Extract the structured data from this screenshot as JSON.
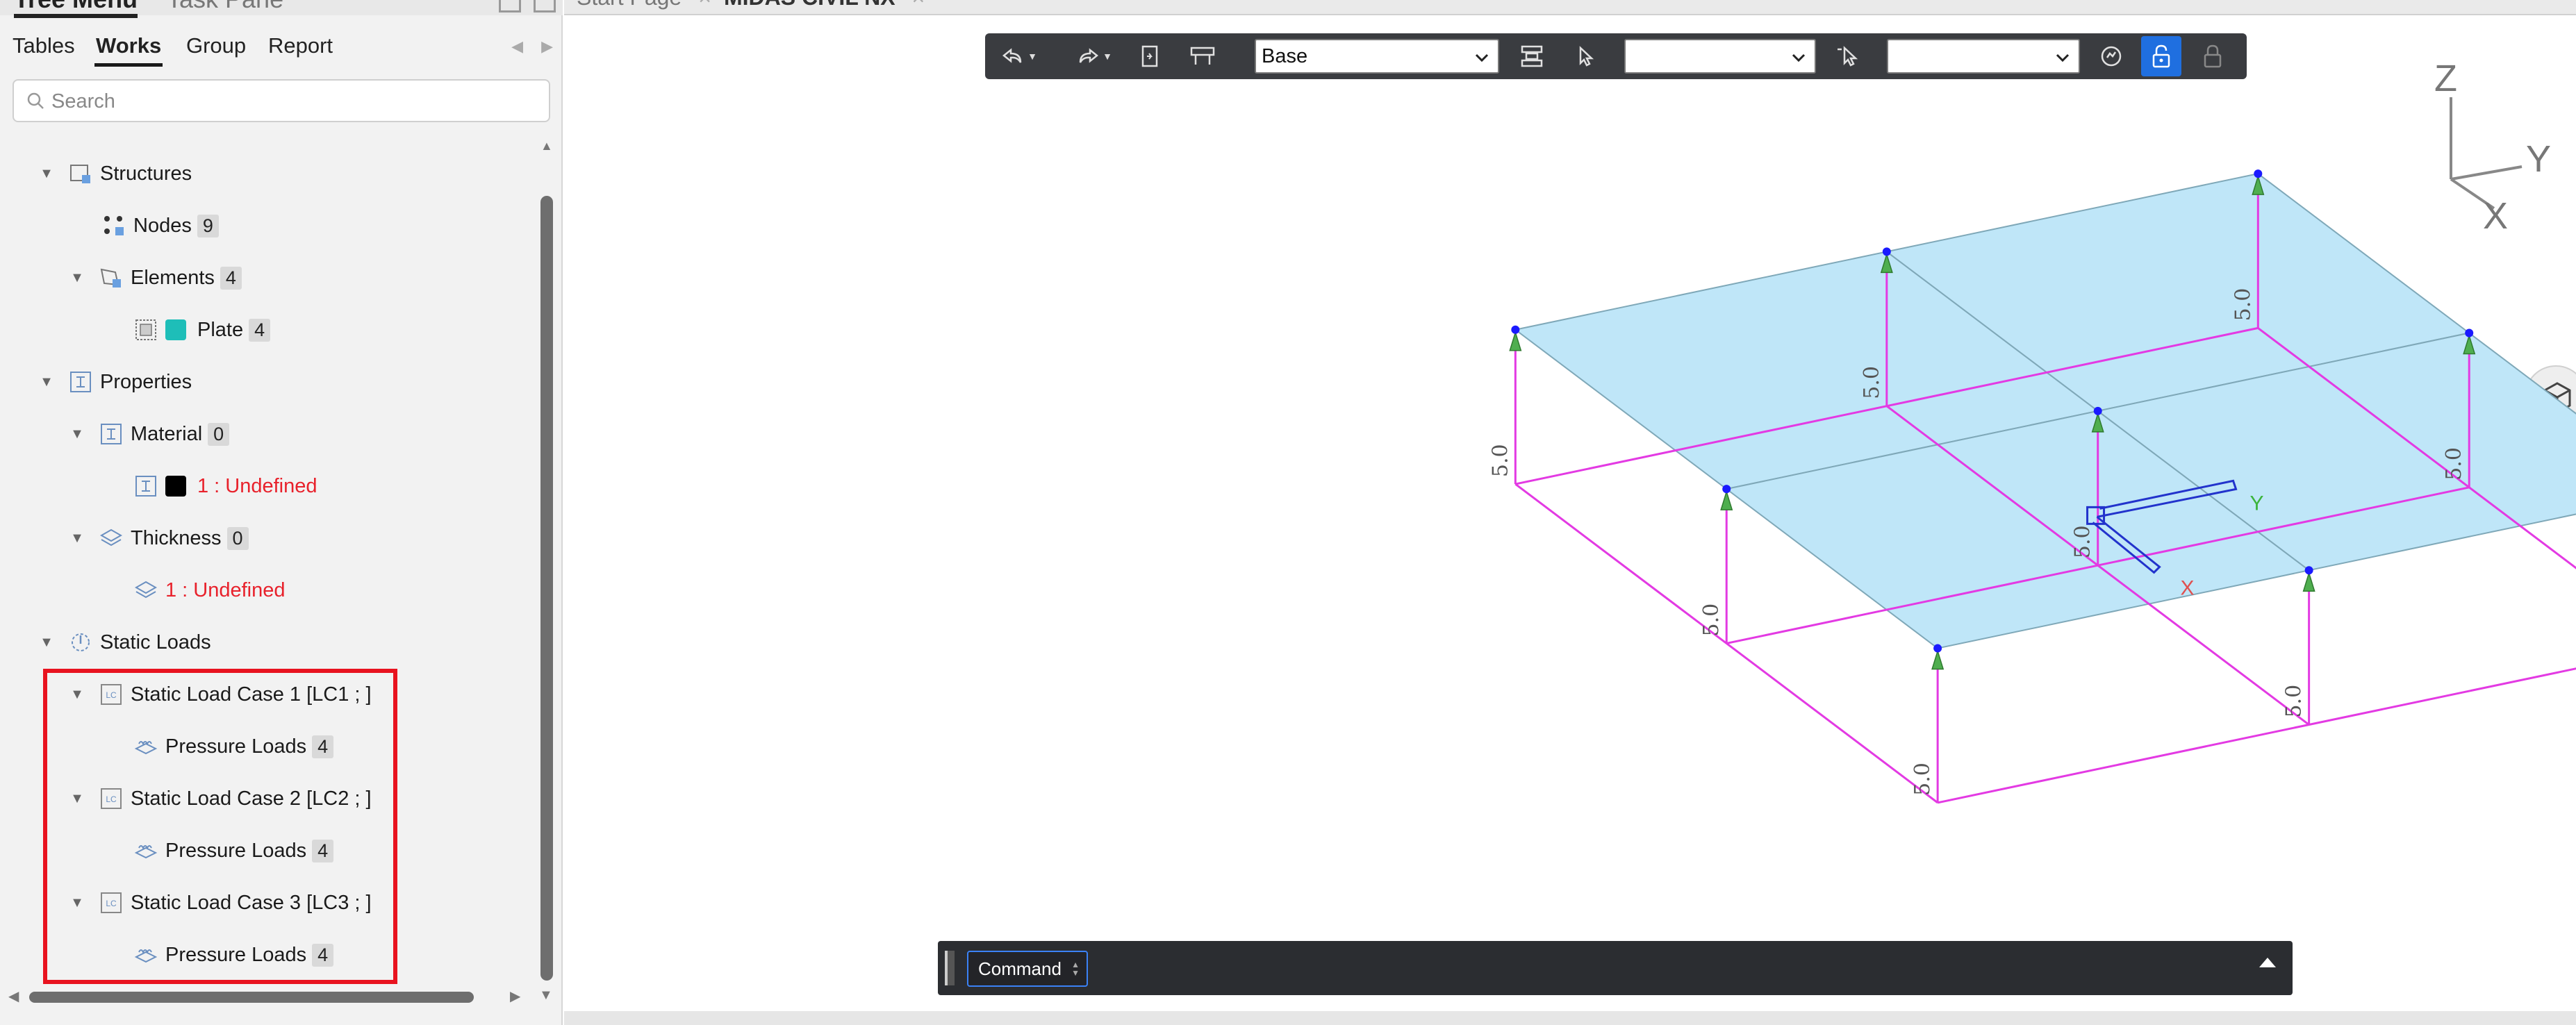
{
  "panel": {
    "title": "Tree Menu",
    "title2": "Task Pane",
    "tabs": [
      "Tables",
      "Works",
      "Group",
      "Report"
    ],
    "active_tab": "Works",
    "search_placeholder": "Search"
  },
  "tree": {
    "structures": "Structures",
    "nodes": {
      "label": "Nodes",
      "count": "9"
    },
    "elements": {
      "label": "Elements",
      "count": "4"
    },
    "plate": {
      "label": "Plate",
      "count": "4",
      "color": "#1ebeb8"
    },
    "properties": "Properties",
    "material": {
      "label": "Material",
      "count": "0"
    },
    "material_item": {
      "label": "1 : Undefined",
      "color": "#000000"
    },
    "thickness": {
      "label": "Thickness",
      "count": "0"
    },
    "thickness_item": "1 : Undefined",
    "static_loads": "Static Loads",
    "lc1": "Static Load Case 1 [LC1 ; ]",
    "lc2": "Static Load Case 2 [LC2 ; ]",
    "lc3": "Static Load Case 3 [LC3 ; ]",
    "pressure_label": "Pressure Loads",
    "pressure_count": "4"
  },
  "doc_tabs": [
    "Start Page",
    "MIDAS CIVIL NX"
  ],
  "toolbar": {
    "view_select": "Base",
    "select2": "",
    "select3": ""
  },
  "axes": {
    "z": "Z",
    "y": "Y",
    "x": "X"
  },
  "model": {
    "support_label": "5.0",
    "local_x": "X",
    "local_y": "Y"
  },
  "command": {
    "label": "Command"
  },
  "colors": {
    "plate_fill": "#bfe6f8",
    "edges": "#e33ae3",
    "support_arrow": "#4fae4f",
    "node": "#1a1aff",
    "highlight": "#e8131f"
  }
}
